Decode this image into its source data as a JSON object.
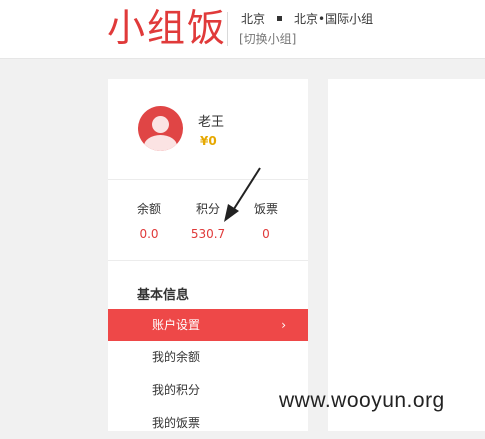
{
  "header": {
    "logo": "小组饭",
    "city": "北京",
    "group": "北京•国际小组",
    "switch_group": "[切换小组]"
  },
  "profile": {
    "username": "老王",
    "vip": "¥0"
  },
  "stats": [
    {
      "label": "余额",
      "value": "0.0"
    },
    {
      "label": "积分",
      "value": "530.7"
    },
    {
      "label": "饭票",
      "value": "0"
    }
  ],
  "menu": {
    "section_title": "基本信息",
    "items": [
      {
        "label": "账户设置",
        "active": true
      },
      {
        "label": "我的余额"
      },
      {
        "label": "我的积分"
      },
      {
        "label": "我的饭票"
      }
    ],
    "active_chevron": "›"
  },
  "watermark": "www.wooyun.org",
  "colors": {
    "brand_red": "#e03a3a",
    "active_menu_bg": "#ee4848",
    "vip_gold": "#e6a800"
  }
}
